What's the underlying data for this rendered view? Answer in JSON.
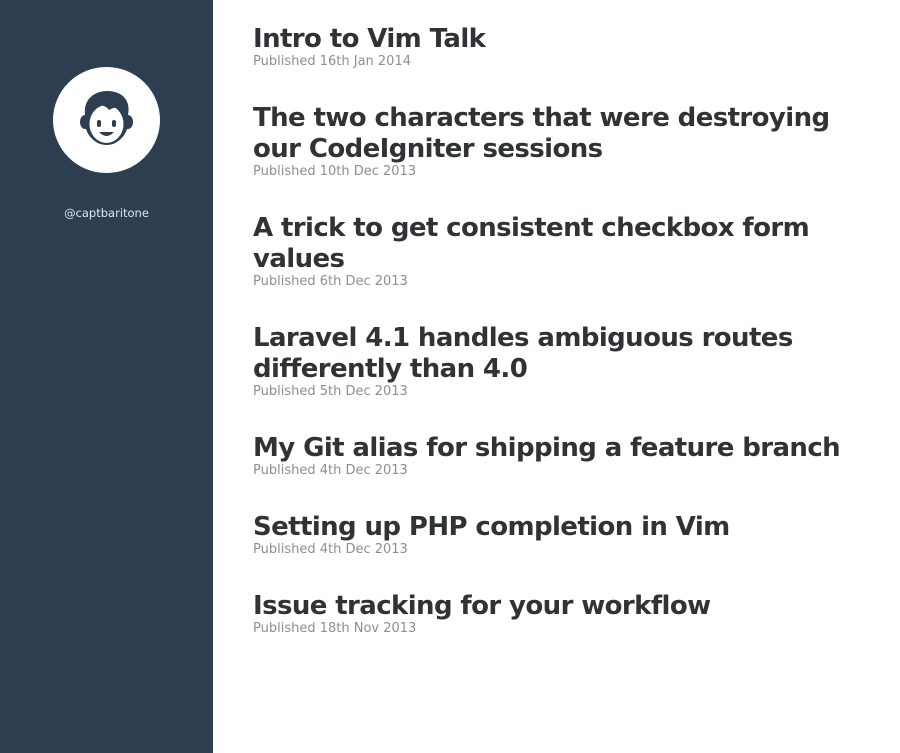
{
  "sidebar": {
    "avatar_icon": "user-avatar-icon",
    "handle": "@captbaritone",
    "background_color": "#2c3e50"
  },
  "posts": [
    {
      "title": "Intro to Vim Talk",
      "date": "Published 16th Jan 2014"
    },
    {
      "title": "The two characters that were destroying our CodeIgniter sessions",
      "date": "Published 10th Dec 2013"
    },
    {
      "title": "A trick to get consistent checkbox form values",
      "date": "Published 6th Dec 2013"
    },
    {
      "title": "Laravel 4.1 handles ambiguous routes differently than 4.0",
      "date": "Published 5th Dec 2013"
    },
    {
      "title": "My Git alias for shipping a feature branch",
      "date": "Published 4th Dec 2013"
    },
    {
      "title": "Setting up PHP completion in Vim",
      "date": "Published 4th Dec 2013"
    },
    {
      "title": "Issue tracking for your workflow",
      "date": "Published 18th Nov 2013"
    }
  ]
}
